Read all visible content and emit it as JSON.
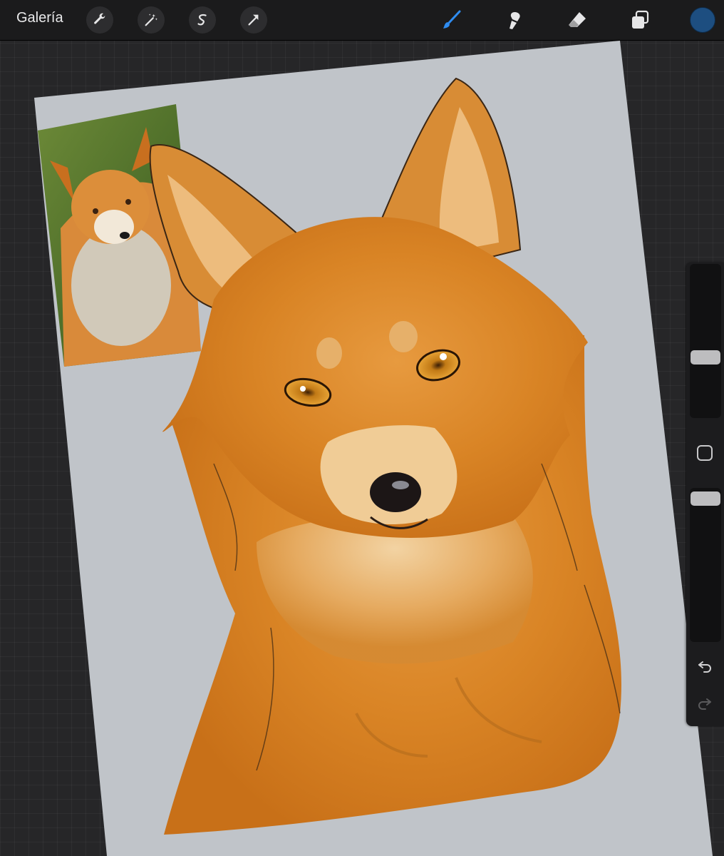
{
  "topbar": {
    "gallery_label": "Galería",
    "left_tools": [
      {
        "name": "actions-wrench-icon"
      },
      {
        "name": "adjustments-magic-wand-icon"
      },
      {
        "name": "selection-icon"
      },
      {
        "name": "transform-arrow-icon"
      }
    ],
    "right_tools": [
      {
        "name": "brush-icon",
        "active": true,
        "color": "#2f8cf0"
      },
      {
        "name": "smudge-icon"
      },
      {
        "name": "eraser-icon"
      },
      {
        "name": "layers-icon"
      }
    ],
    "current_color": "#1d4e80"
  },
  "canvas": {
    "paper_color": "#c0c4c9",
    "artwork": "fox-portrait-painting",
    "reference": "fox-reference-photo"
  },
  "sidebar": {
    "brush_size_label": "",
    "opacity_label": "",
    "undo_icon": "undo-icon",
    "redo_icon": "redo-icon"
  }
}
